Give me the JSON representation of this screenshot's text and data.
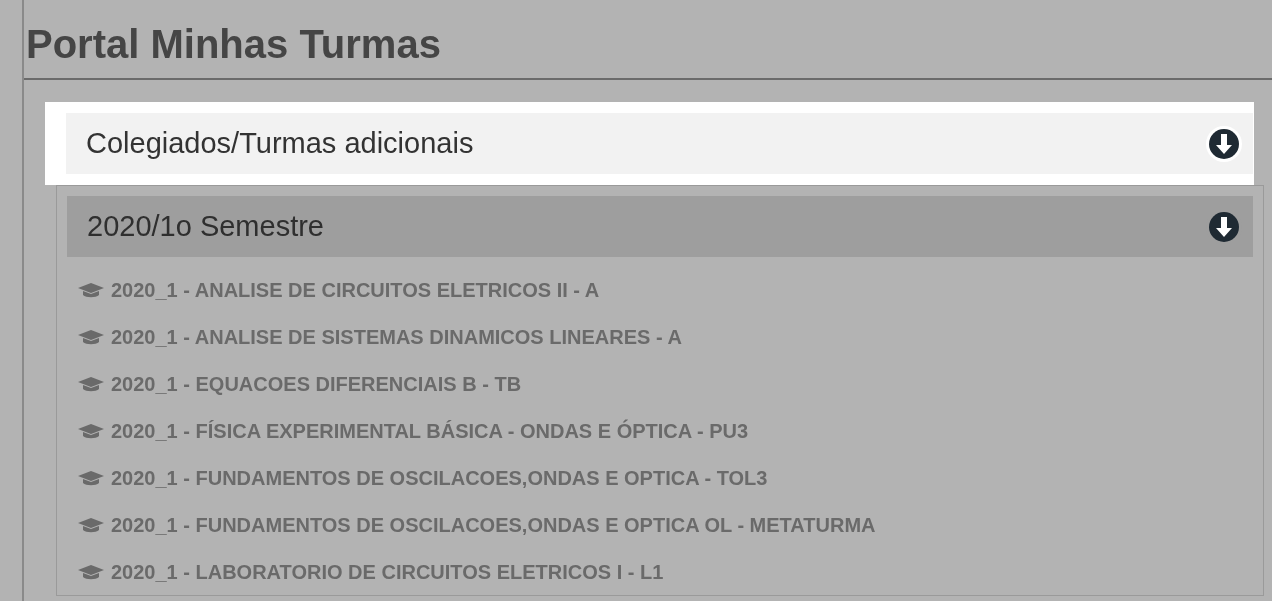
{
  "page_title": "Portal Minhas Turmas",
  "panels": [
    {
      "title": "Colegiados/Turmas adicionais",
      "highlighted": true
    },
    {
      "title": "2020/1o Semestre",
      "highlighted": false,
      "items": [
        "2020_1 - ANALISE DE CIRCUITOS ELETRICOS II - A",
        "2020_1 - ANALISE DE SISTEMAS DINAMICOS LINEARES - A",
        "2020_1 - EQUACOES DIFERENCIAIS B - TB",
        "2020_1 - FÍSICA EXPERIMENTAL BÁSICA - ONDAS E ÓPTICA - PU3",
        "2020_1 - FUNDAMENTOS DE OSCILACOES,ONDAS E OPTICA - TOL3",
        "2020_1 - FUNDAMENTOS DE OSCILACOES,ONDAS E OPTICA OL - METATURMA",
        "2020_1 - LABORATORIO DE CIRCUITOS ELETRICOS I - L1"
      ]
    }
  ]
}
